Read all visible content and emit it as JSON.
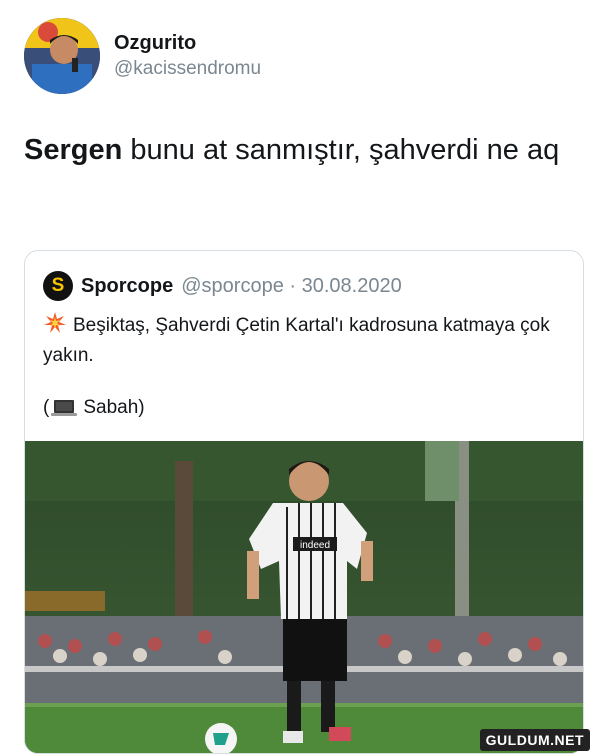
{
  "author": {
    "display_name": "Ozgurito",
    "handle": "@kacissendromu"
  },
  "tweet": {
    "bold_word": "Sergen",
    "rest_text": " bunu at sanmıştır, şahverdi ne aq"
  },
  "quoted_tweet": {
    "logo_glyph": "S",
    "name": "Sporcope",
    "meta": "@sporcope · 30.08.2020",
    "emoji_icon": "collision-icon",
    "body_text": "Beşiktaş, Şahverdi Çetin Kartal'ı kadrosuna katmaya çok yakın.",
    "source_open": "(",
    "source_icon": "laptop-icon",
    "source_text": "Sabah)",
    "photo": {
      "description_icon": "football-player-photo",
      "shirt_sponsor": "indeed"
    }
  },
  "watermark": "GULDUM.NET",
  "colors": {
    "text": "#14171a",
    "secondary": "#7b8790",
    "border": "#d6dde3",
    "logo_accent": "#f6c400"
  }
}
